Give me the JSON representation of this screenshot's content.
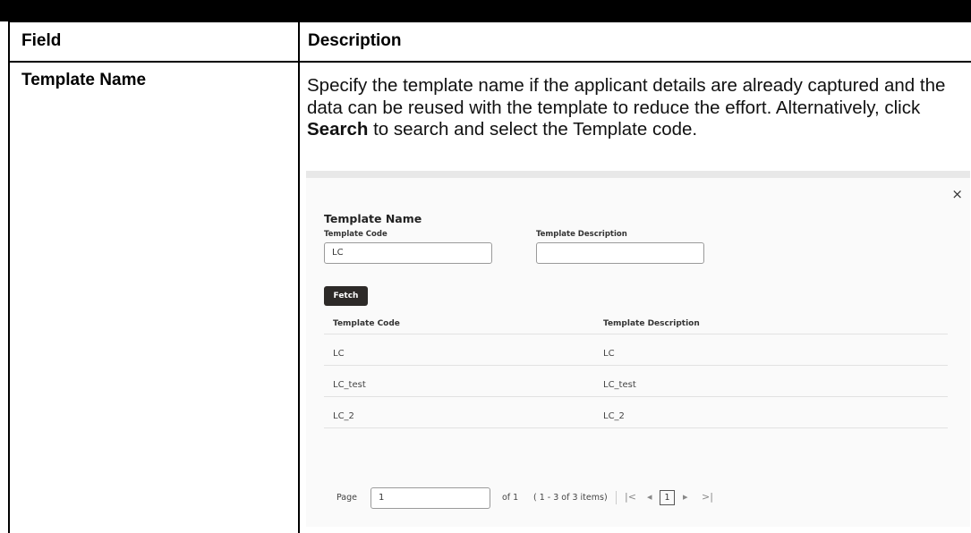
{
  "table": {
    "header_field": "Field",
    "header_description": "Description",
    "row_field": "Template Name",
    "row_desc_before": "Specify the template name if the applicant details are already captured and the data can be reused with the template to reduce the effort. Alternatively, click ",
    "row_desc_bold": "Search",
    "row_desc_after": " to search and select the Template code."
  },
  "dialog": {
    "close_glyph": "×",
    "title": "Template Name",
    "code_label": "Template Code",
    "code_value": "LC",
    "desc_label": "Template Description",
    "desc_value": "",
    "fetch_label": "Fetch",
    "columns": [
      "Template Code",
      "Template Description"
    ],
    "rows": [
      [
        "LC",
        "LC"
      ],
      [
        "LC_test",
        "LC_test"
      ],
      [
        "LC_2",
        "LC_2"
      ]
    ],
    "pager": {
      "page_label": "Page",
      "page_value": "1",
      "of_text": "of 1",
      "range_text": "( 1 - 3 of 3 items)",
      "first_glyph": "|<",
      "prev_glyph": "◂",
      "current": "1",
      "next_glyph": "▸",
      "last_glyph": ">|"
    }
  }
}
